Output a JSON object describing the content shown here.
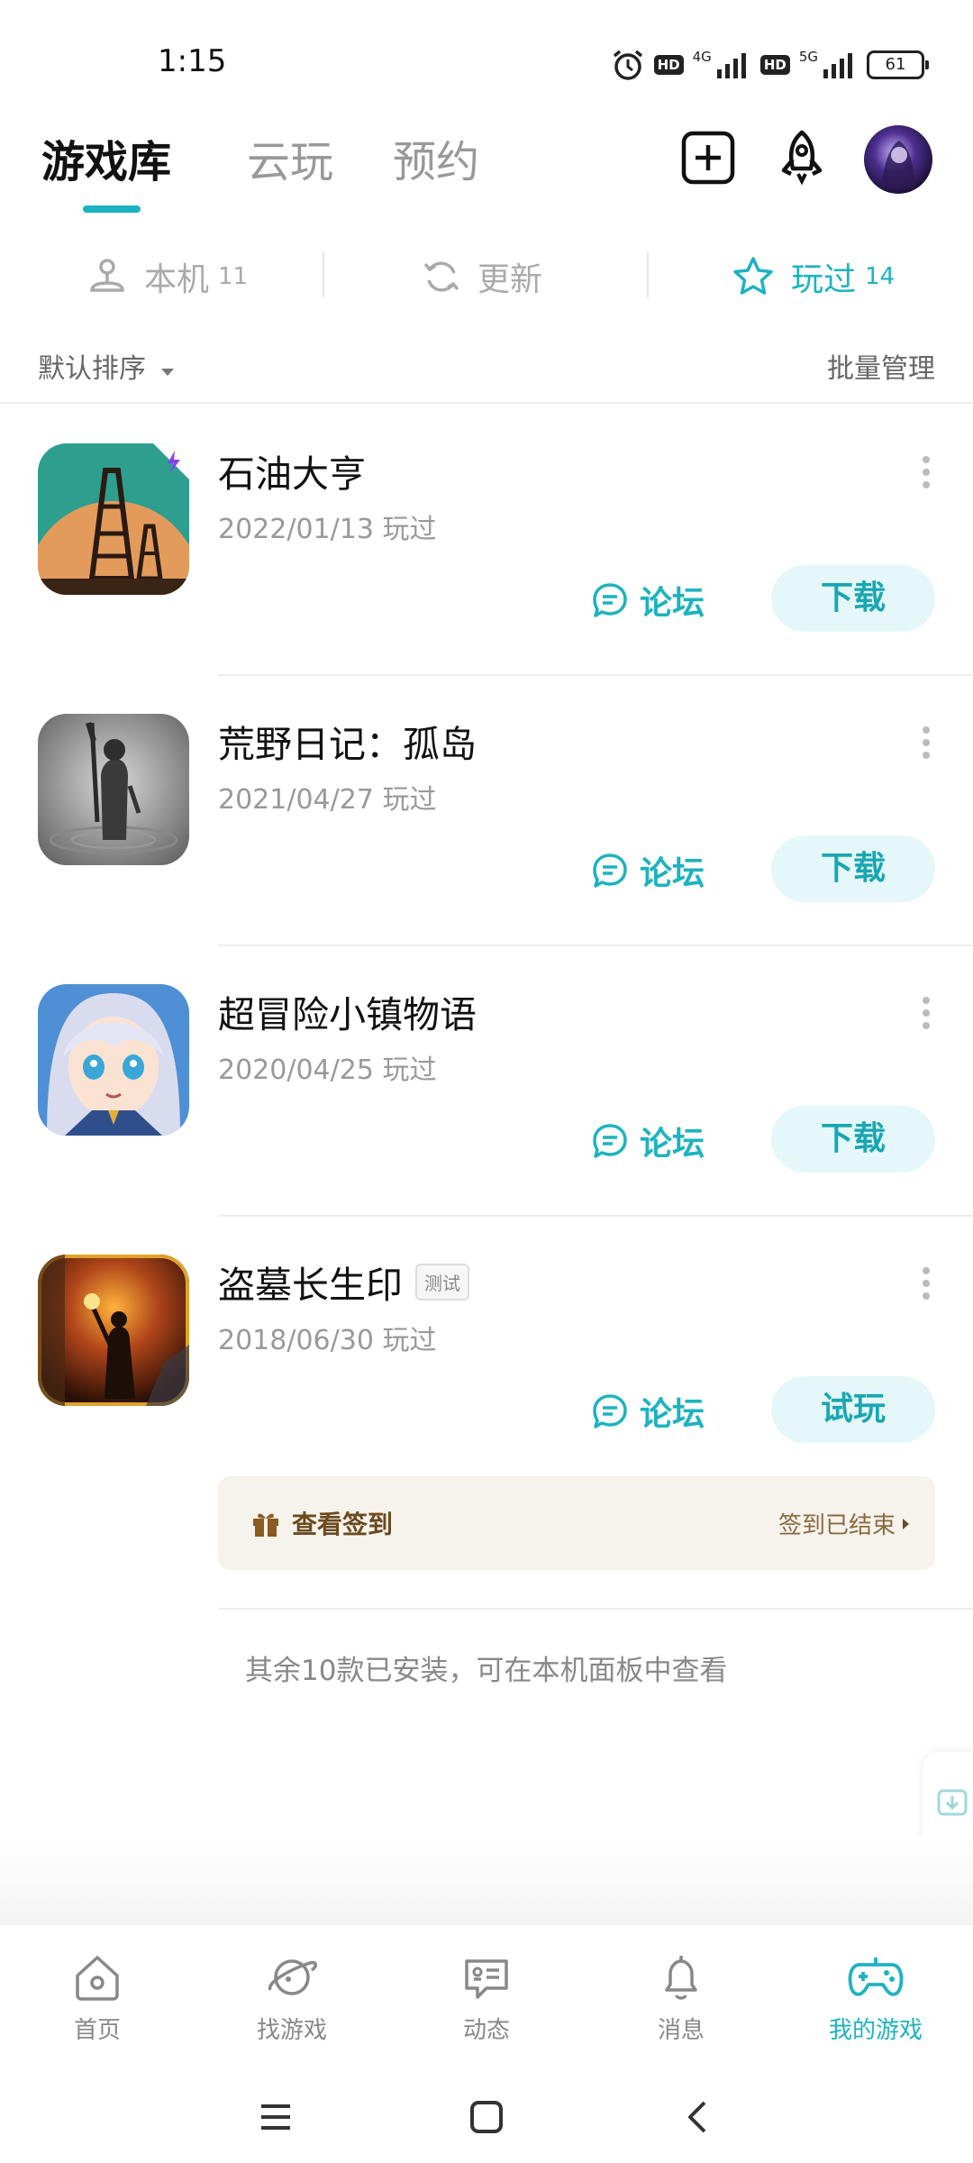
{
  "status_bar": {
    "time": "1:15",
    "hd1": "HD",
    "net1": "4G",
    "hd2": "HD",
    "net2": "5G",
    "battery": "61"
  },
  "header": {
    "tabs": [
      {
        "label": "游戏库",
        "active": true
      },
      {
        "label": "云玩",
        "active": false
      },
      {
        "label": "预约",
        "active": false
      }
    ],
    "icons": [
      "add-icon",
      "rocket-icon",
      "avatar"
    ]
  },
  "filters": [
    {
      "label": "本机",
      "count": "11",
      "icon": "joystick-icon",
      "active": false
    },
    {
      "label": "更新",
      "count": "",
      "icon": "refresh-icon",
      "active": false
    },
    {
      "label": "玩过",
      "count": "14",
      "icon": "star-icon",
      "active": true
    }
  ],
  "toolbar": {
    "sort_label": "默认排序",
    "batch_label": "批量管理"
  },
  "games": [
    {
      "name": "石油大亨",
      "date": "2022/01/13 玩过",
      "forum": "论坛",
      "action": "下载",
      "badge": ""
    },
    {
      "name": "荒野日记：孤岛",
      "date": "2021/04/27 玩过",
      "forum": "论坛",
      "action": "下载",
      "badge": ""
    },
    {
      "name": "超冒险小镇物语",
      "date": "2020/04/25 玩过",
      "forum": "论坛",
      "action": "下载",
      "badge": ""
    },
    {
      "name": "盗墓长生印",
      "date": "2018/06/30 玩过",
      "forum": "论坛",
      "action": "试玩",
      "badge": "测试"
    }
  ],
  "checkin": {
    "left_label": "查看签到",
    "right_label": "签到已结束"
  },
  "footer_note": "其余10款已安装，可在本机面板中查看",
  "bottom_nav": [
    {
      "label": "首页",
      "icon": "home-icon",
      "active": false
    },
    {
      "label": "找游戏",
      "icon": "planet-icon",
      "active": false
    },
    {
      "label": "动态",
      "icon": "feed-icon",
      "active": false
    },
    {
      "label": "消息",
      "icon": "bell-icon",
      "active": false
    },
    {
      "label": "我的游戏",
      "icon": "gamepad-icon",
      "active": true
    }
  ],
  "colors": {
    "accent": "#1cb3c0",
    "button_bg": "#e5f7f8",
    "checkin_bg": "#f6f2ec"
  }
}
